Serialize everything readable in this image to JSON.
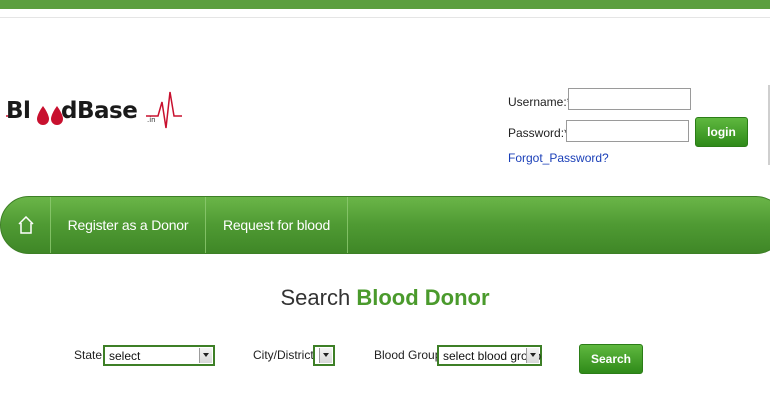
{
  "brand": {
    "logo_prefix": "Bl",
    "logo_drops": "oo",
    "logo_suffix": "dBase",
    "logo_tld": ".in"
  },
  "login": {
    "username_label": "Username:*",
    "username_value": "",
    "password_label": "Password:*",
    "password_value": "",
    "login_button": "login",
    "forgot_link": "Forgot_Password?"
  },
  "nav": {
    "home_icon": "home-icon",
    "items": [
      {
        "label": "Register as a Donor"
      },
      {
        "label": "Request for blood"
      }
    ]
  },
  "search": {
    "title_prefix": "Search",
    "title_accent": "Blood Donor",
    "state_label": "State",
    "state_value": "select",
    "city_label": "City/District",
    "city_value": "",
    "blood_group_label": "Blood Group",
    "blood_group_value": "select blood group",
    "search_button": "Search"
  },
  "colors": {
    "brand_green": "#4a9a2c",
    "nav_green": "#4f9a33",
    "link_blue": "#1a3fb8",
    "logo_red": "#c8102e"
  }
}
